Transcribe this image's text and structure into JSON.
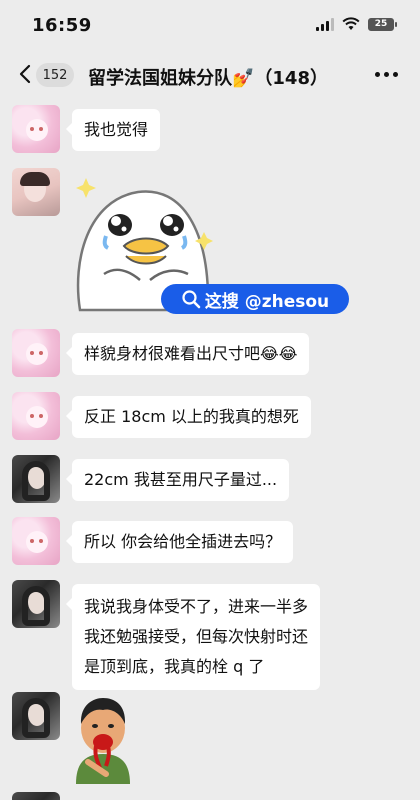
{
  "status_bar": {
    "time": "16:59",
    "battery": "25"
  },
  "header": {
    "unread_count": "152",
    "chat_title": "留学法国姐妹分队💅（148）"
  },
  "watermark": {
    "text": "这搜 @zhesou"
  },
  "messages": [
    {
      "sender_avatar": "pink-anime-avatar",
      "text": "我也觉得"
    },
    {
      "sender_avatar": "photo-girl-avatar",
      "sticker": "crying-duck-sticker"
    },
    {
      "sender_avatar": "pink-anime-avatar",
      "text": "样貌身材很难看出尺寸吧😂😂"
    },
    {
      "sender_avatar": "pink-anime-avatar",
      "text": "反正 18cm 以上的我真的想死"
    },
    {
      "sender_avatar": "dark-hair-avatar",
      "text": "22cm 我甚至用尺子量过..."
    },
    {
      "sender_avatar": "pink-anime-avatar",
      "text": "所以 你会给他全插进去吗？"
    },
    {
      "sender_avatar": "dark-hair-avatar",
      "lines": [
        "我说我身体受不了，进来一半多",
        "我还勉强接受，但每次快射时还",
        "是顶到底，我真的栓 q 了"
      ]
    },
    {
      "sender_avatar": "dark-hair-avatar",
      "sticker": "bleeding-man-sticker"
    }
  ]
}
